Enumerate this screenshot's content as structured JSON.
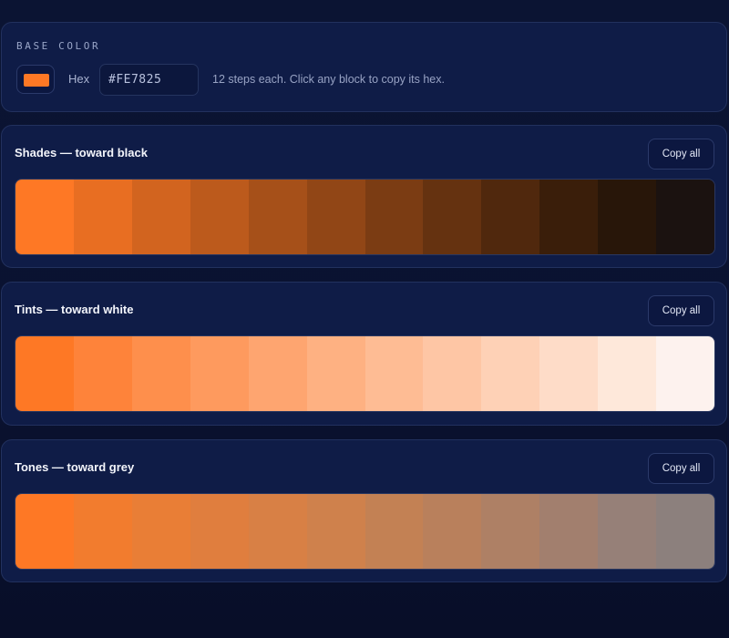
{
  "base": {
    "label": "BASE COLOR",
    "hex_label": "Hex",
    "hex_value": "#FE7825",
    "helper": "12 steps each. Click any block to copy its hex.",
    "swatch_color": "#FE7825"
  },
  "sections": [
    {
      "title": "Shades — toward black",
      "copy_label": "Copy all",
      "colors": [
        "#FE7825",
        "#E86E22",
        "#D2641F",
        "#BC5A1C",
        "#A65019",
        "#914616",
        "#7B3C13",
        "#653210",
        "#50280D",
        "#3A1E0A",
        "#281609",
        "#1B1210"
      ]
    },
    {
      "title": "Tints — toward white",
      "copy_label": "Copy all",
      "colors": [
        "#FE7825",
        "#FE833A",
        "#FE8F4C",
        "#FE9A5E",
        "#FEA570",
        "#FEB182",
        "#FEBC94",
        "#FEC6A5",
        "#FED1B6",
        "#FEDCC8",
        "#FEE8DA",
        "#FDF2EE"
      ]
    },
    {
      "title": "Tones — toward grey",
      "copy_label": "Copy all",
      "colors": [
        "#FE7825",
        "#F27C2E",
        "#E97E36",
        "#E07E3E",
        "#D88045",
        "#CF814C",
        "#C38154",
        "#B9805C",
        "#AE8065",
        "#A27F6E",
        "#968078",
        "#8C807D"
      ]
    }
  ]
}
